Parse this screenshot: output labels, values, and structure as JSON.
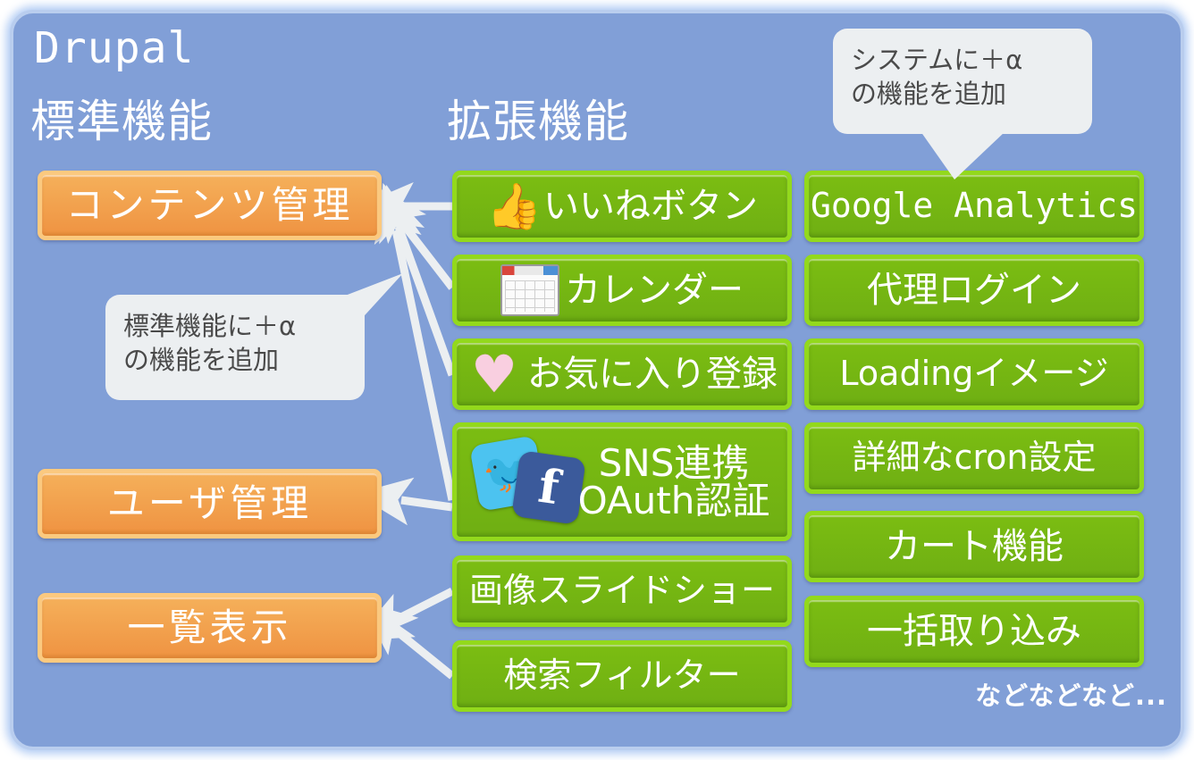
{
  "headings": {
    "product": "Drupal",
    "standard": "標準機能",
    "extension": "拡張機能"
  },
  "standard_features": [
    {
      "label": "コンテンツ管理"
    },
    {
      "label": "ユーザ管理"
    },
    {
      "label": "一覧表示"
    }
  ],
  "extension_column1": [
    {
      "label": "いいねボタン",
      "icon": "thumbs-up-icon"
    },
    {
      "label": "カレンダー",
      "icon": "calendar-icon"
    },
    {
      "label": "お気に入り登録",
      "icon": "heart-icon"
    },
    {
      "label_line1": "SNS連携",
      "label_line2": "OAuth認証",
      "icon": "sns-icon"
    },
    {
      "label": "画像スライドショー",
      "icon": ""
    },
    {
      "label": "検索フィルター",
      "icon": ""
    }
  ],
  "extension_column2": [
    {
      "label": "Google Analytics"
    },
    {
      "label": "代理ログイン"
    },
    {
      "label": "Loadingイメージ"
    },
    {
      "label": "詳細なcron設定"
    },
    {
      "label": "カート機能"
    },
    {
      "label": "一括取り込み"
    }
  ],
  "callouts": {
    "system": "システムに＋α\nの機能を追加",
    "standard": "標準機能に＋α\nの機能を追加"
  },
  "footer_note": "などなどなど...",
  "icons": {
    "thumbs_up": "👍",
    "heart": "♥",
    "twitter": "🐦",
    "facebook": "f"
  },
  "colors": {
    "panel_background": "#819fd7",
    "panel_border": "#b9cdee",
    "orange_box": "#ef9342",
    "orange_border": "#fbc97f",
    "green_box": "#6faf13",
    "green_border": "#93d91c",
    "bubble": "#eceff1",
    "arrow": "#eceff1",
    "text": "#ffffff"
  }
}
